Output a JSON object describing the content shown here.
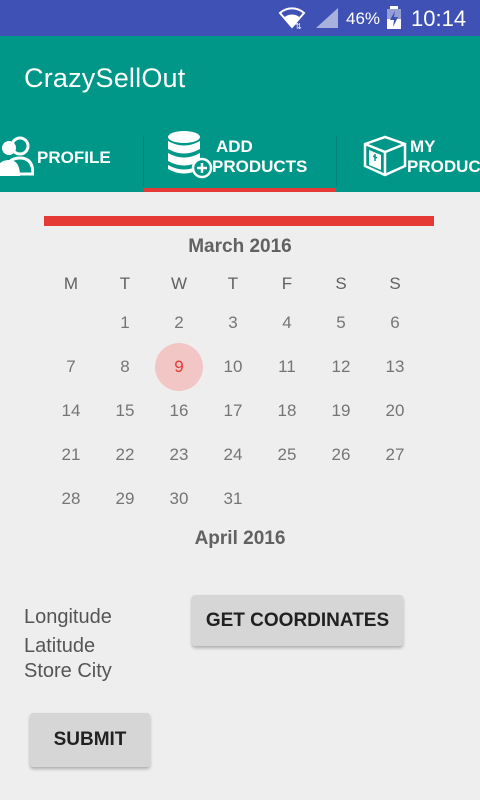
{
  "status_bar": {
    "battery_percent": "46%",
    "time": "10:14"
  },
  "app": {
    "title": "CrazySellOut"
  },
  "tabs": [
    {
      "label_line1": "PROFILE",
      "label_line2": "",
      "icon": "profile-icon"
    },
    {
      "label_line1": "ADD",
      "label_line2": "PRODUCTS",
      "icon": "database-add-icon",
      "selected": true
    },
    {
      "label_line1": "MY",
      "label_line2": "PRODUCTS",
      "icon": "box-icon"
    }
  ],
  "calendar": {
    "month_current": "March 2016",
    "month_next": "April 2016",
    "weekdays": [
      "M",
      "T",
      "W",
      "T",
      "F",
      "S",
      "S"
    ],
    "weeks": [
      [
        "",
        "1",
        "2",
        "3",
        "4",
        "5",
        "6"
      ],
      [
        "7",
        "8",
        "9",
        "10",
        "11",
        "12",
        "13"
      ],
      [
        "14",
        "15",
        "16",
        "17",
        "18",
        "19",
        "20"
      ],
      [
        "21",
        "22",
        "23",
        "24",
        "25",
        "26",
        "27"
      ],
      [
        "28",
        "29",
        "30",
        "31",
        "",
        "",
        ""
      ]
    ],
    "selected_day": "9"
  },
  "form": {
    "longitude_label": "Longitude",
    "latitude_label": "Latitude",
    "store_city_label": "Store City",
    "get_coordinates_label": "GET COORDINATES",
    "submit_label": "SUBMIT"
  },
  "colors": {
    "status_bar": "#3f51b5",
    "app_bar": "#009688",
    "accent": "#e53935",
    "background": "#eeeeee"
  }
}
